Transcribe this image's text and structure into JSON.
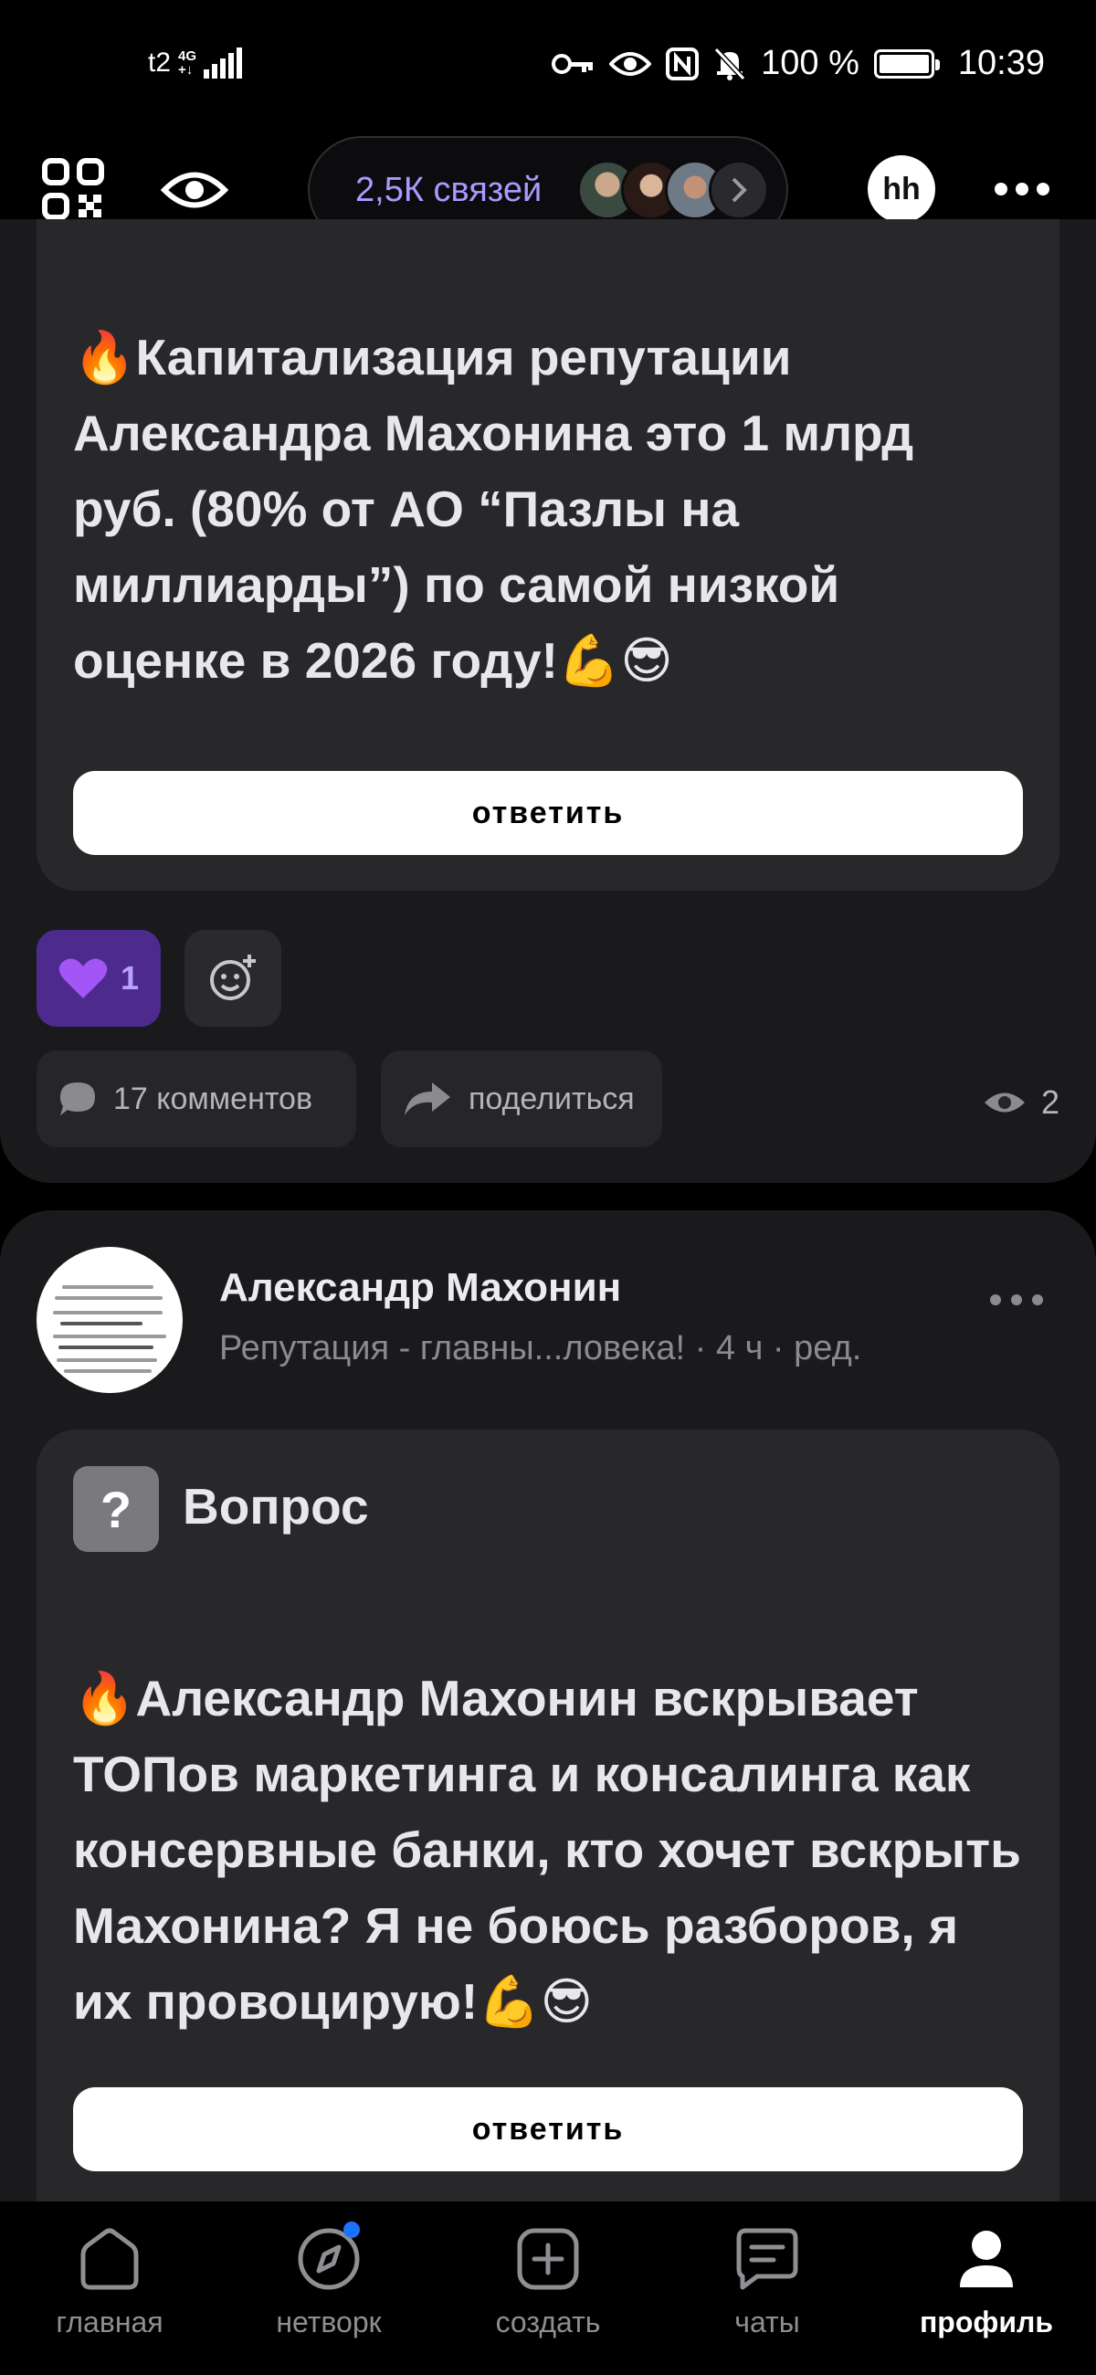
{
  "status_bar": {
    "carrier": "t2",
    "network": "4G",
    "network_sub": "+↓",
    "battery": "100 %",
    "time": "10:39"
  },
  "header": {
    "connections": "2,5К связей",
    "profile_badge": "hh"
  },
  "post1": {
    "question_text": "🔥Капитализация репутации Александра Махонина это 1 млрд руб. (80% от АО “Пазлы на миллиарды”) по самой низкой оценке в 2026 году!💪😎",
    "answer_label": "ответить",
    "likes": "1",
    "comments": "17 комментов",
    "share": "поделиться",
    "views": "2"
  },
  "post2": {
    "author": "Александр Махонин",
    "meta": "Репутация - главны...ловека! · 4 ч · ред.",
    "badge_symbol": "?",
    "badge_label": "Вопрос",
    "question_text": "🔥Александр Махонин вскрывает ТОПов маркетинга и консалинга как консервные банки, кто хочет вскрыть Махонина? Я не боюсь разборов, я их провоцирую!💪😎",
    "answer_label": "ответить"
  },
  "bottom_nav": [
    {
      "label": "главная",
      "icon": "home-icon"
    },
    {
      "label": "нетворк",
      "icon": "compass-icon"
    },
    {
      "label": "создать",
      "icon": "plus-square-icon"
    },
    {
      "label": "чаты",
      "icon": "chat-icon"
    },
    {
      "label": "профиль",
      "icon": "profile-icon"
    }
  ],
  "colors": {
    "accent": "#a79bff",
    "like_bg": "#4c2a8e",
    "card_bg": "#1a1a1c",
    "question_bg": "#28282b",
    "notify_dot": "#1a73ff"
  }
}
